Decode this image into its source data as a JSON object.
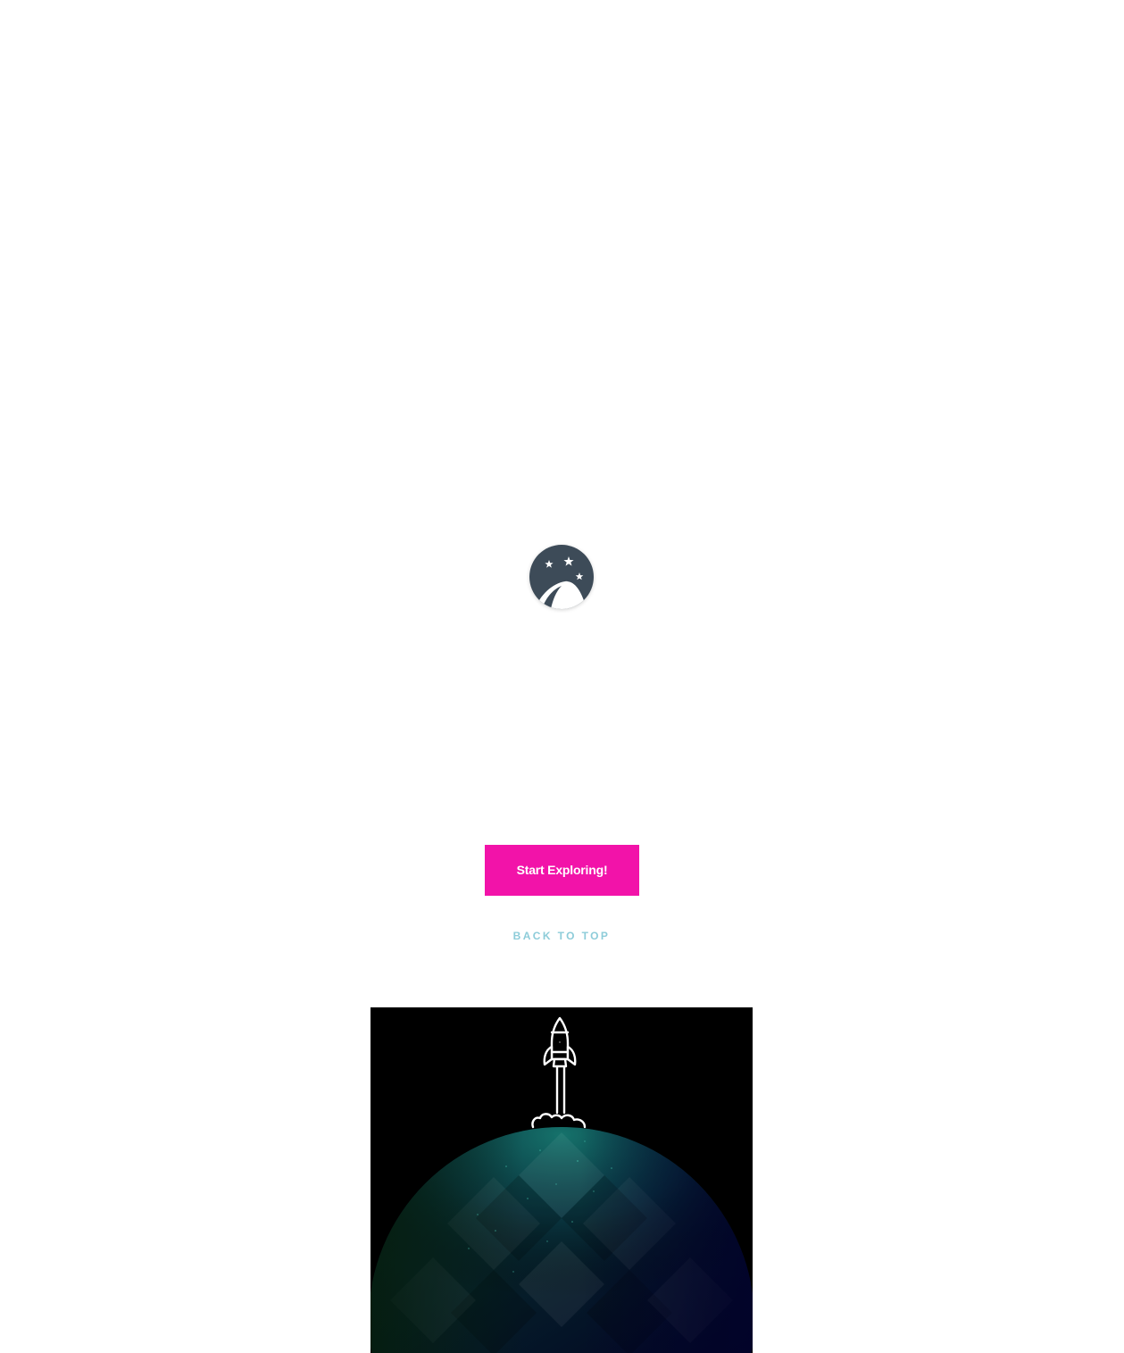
{
  "colors": {
    "page_background": "#ffffff",
    "logo_background": "#3d4b58",
    "accent": "#f213a9",
    "button_text": "#ffffff",
    "link": "#8dccd9",
    "illustration_background": "#000000",
    "planet_teal": "#0f5f5a",
    "planet_blue": "#0a1f5f",
    "planet_green": "#08361f"
  },
  "icons": {
    "logo": "night-sky-hill-icon",
    "rocket": "rocket-icon",
    "planet": "planet-icon"
  },
  "cta": {
    "label": "Start Exploring!"
  },
  "footer": {
    "back_to_top": "BACK TO TOP"
  }
}
